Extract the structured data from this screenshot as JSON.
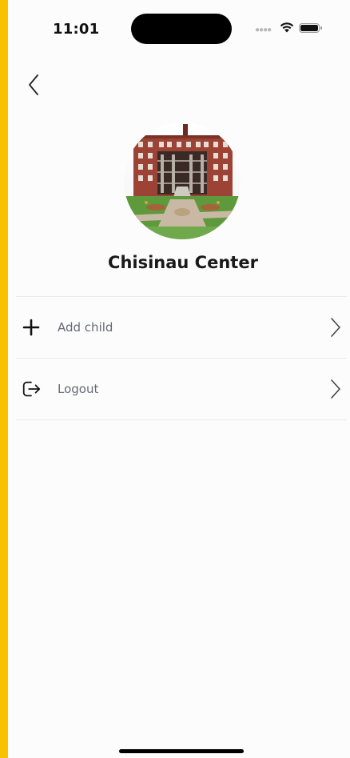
{
  "status_bar": {
    "time": "11:01",
    "signal_icon": "signal-dots-icon",
    "wifi_icon": "wifi-icon",
    "battery_icon": "battery-icon"
  },
  "header": {
    "back_icon": "chevron-left-icon"
  },
  "profile": {
    "name": "Chisinau Center",
    "avatar": "building-photo"
  },
  "menu": {
    "items": [
      {
        "label": "Add child",
        "icon": "plus-icon",
        "trailing_icon": "chevron-right-icon"
      },
      {
        "label": "Logout",
        "icon": "logout-icon",
        "trailing_icon": "chevron-right-icon"
      }
    ]
  },
  "colors": {
    "frame": "#F9C200",
    "background": "#FCFCFC",
    "label": "#666B73",
    "divider": "#EBEBEB"
  }
}
